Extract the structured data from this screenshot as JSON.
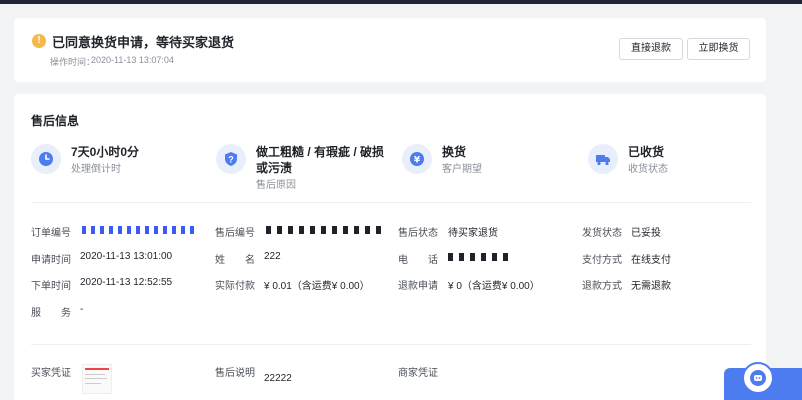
{
  "status": {
    "title": "已同意换货申请，等待买家退货",
    "time_label": "操作时间：",
    "time_value": "2020-11-13 13:07:04",
    "buttons": {
      "direct_refund": "直接退款",
      "exchange_now": "立即换货"
    }
  },
  "after_sale": {
    "section_title": "售后信息",
    "summary": [
      {
        "icon": "clock-icon",
        "main": "7天0小时0分",
        "sub": "处理倒计时"
      },
      {
        "icon": "question-shield-icon",
        "main": "做工粗糙 / 有瑕疵 / 破损",
        "main2": "或污渍",
        "sub": "售后原因"
      },
      {
        "icon": "yen-exchange-icon",
        "main": "换货",
        "sub": "客户期望"
      },
      {
        "icon": "truck-icon",
        "main": "已收货",
        "sub": "收货状态"
      }
    ],
    "fields": {
      "order_no_label": "订单编号",
      "after_sale_no_label": "售后编号",
      "after_sale_status_label": "售后状态",
      "after_sale_status_value": "待买家退货",
      "ship_status_label": "发货状态",
      "ship_status_value": "已妥投",
      "apply_time_label": "申请时间",
      "apply_time_value": "2020-11-13 13:01:00",
      "name_label": "姓　　名",
      "name_value": "222",
      "phone_label": "电　　话",
      "pay_method_label": "支付方式",
      "pay_method_value": "在线支付",
      "order_time_label": "下单时间",
      "order_time_value": "2020-11-13 12:52:55",
      "actual_paid_label": "实际付款",
      "actual_paid_value": "¥ 0.01（含运费¥ 0.00）",
      "refund_apply_label": "退款申请",
      "refund_apply_value": "¥ 0（含运费¥ 0.00）",
      "refund_method_label": "退款方式",
      "refund_method_value": "无需退款",
      "service_label": "服　　务",
      "service_value": "-"
    },
    "vouchers": {
      "buyer_label": "买家凭证",
      "desc_label": "售后说明",
      "desc_value": "22222",
      "merchant_label": "商家凭证"
    }
  },
  "colors": {
    "accent": "#4d7cf0",
    "warning": "#f5b94a",
    "background": "#f2f3f5"
  }
}
